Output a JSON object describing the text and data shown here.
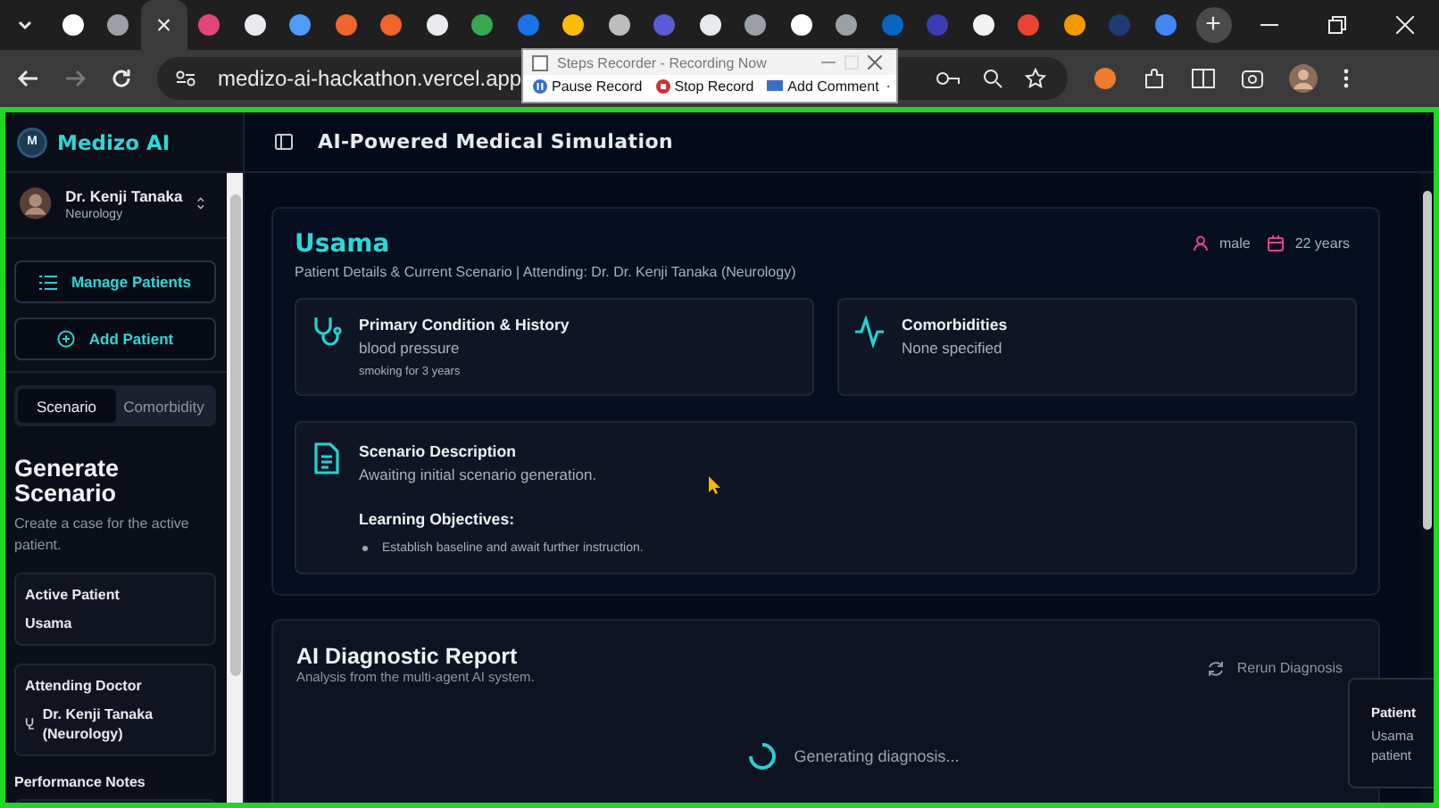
{
  "browser": {
    "tabs": [
      {
        "color": "#ffffff",
        "selected": false
      },
      {
        "color": "#9aa0a6",
        "selected": false
      },
      {
        "selected": true
      },
      {
        "color": "#e0457b",
        "selected": false
      },
      {
        "color": "#e8eaed",
        "selected": false
      },
      {
        "color": "#4f9cf7",
        "selected": false
      },
      {
        "color": "#f0642d",
        "selected": false
      },
      {
        "color": "#f0642d",
        "selected": false
      },
      {
        "color": "#e8eaed",
        "selected": false
      },
      {
        "color": "#34a853",
        "selected": false
      },
      {
        "color": "#1a73e8",
        "selected": false
      },
      {
        "color": "#fbbc05",
        "selected": false
      },
      {
        "color": "#bdbdbd",
        "selected": false
      },
      {
        "color": "#5b5bd6",
        "selected": false
      },
      {
        "color": "#e8eaed",
        "selected": false
      },
      {
        "color": "#9aa0a6",
        "selected": false
      },
      {
        "color": "#ffffff",
        "selected": false
      },
      {
        "color": "#9aa0a6",
        "selected": false
      },
      {
        "color": "#0a66c2",
        "selected": false
      },
      {
        "color": "#3b3bb5",
        "selected": false
      },
      {
        "color": "#f2f2f2",
        "selected": false
      },
      {
        "color": "#ea4335",
        "selected": false
      },
      {
        "color": "#f29900",
        "selected": false
      },
      {
        "color": "#1f3b73",
        "selected": false
      },
      {
        "color": "#4285f4",
        "selected": false
      }
    ],
    "close_glyph": "×",
    "new_tab": "+",
    "address": "medizo-ai-hackathon.vercel.app"
  },
  "recorder": {
    "title": "Steps Recorder - Recording Now",
    "buttons": [
      {
        "kind": "pause",
        "label": "Pause Record"
      },
      {
        "kind": "stop",
        "label": "Stop Record"
      },
      {
        "kind": "comment",
        "label": "Add Comment"
      }
    ]
  },
  "sidebar": {
    "brand": "Medizo AI",
    "logo": "M",
    "user": {
      "name": "Dr. Kenji Tanaka",
      "dept": "Neurology"
    },
    "nav": [
      {
        "kind": "list",
        "label": "Manage Patients"
      },
      {
        "kind": "add",
        "label": "Add Patient"
      }
    ],
    "tabs": [
      {
        "label": "Scenario",
        "selected": true
      },
      {
        "label": "Comorbidity",
        "selected": false
      }
    ],
    "title": "Generate Scenario",
    "subtitle": "Create a case for the active patient.",
    "fields": [
      {
        "kind": "text",
        "label": "Active Patient",
        "value": "Usama"
      },
      {
        "kind": "doctor",
        "label": "Attending Doctor",
        "value": "Dr. Kenji Tanaka (Neurology)"
      }
    ],
    "notes_label": "Performance Notes"
  },
  "header": {
    "title": "AI-Powered Medical Simulation"
  },
  "patient": {
    "name": "Usama",
    "subtitle": "Patient Details & Current Scenario | Attending: Dr. Dr. Kenji Tanaka (Neurology)",
    "sex": "male",
    "age": "22 years",
    "cards": [
      {
        "kind": "stethoscope",
        "title": "Primary Condition & History",
        "lines": [
          "blood pressure",
          "smoking for 3 years"
        ]
      },
      {
        "kind": "pulse",
        "title": "Comorbidities",
        "lines": [
          "None specified"
        ]
      }
    ],
    "scenario": {
      "title": "Scenario Description",
      "text": "Awaiting initial scenario generation.",
      "objectives_title": "Learning Objectives:",
      "objectives": [
        "Establish baseline and await further instruction."
      ]
    }
  },
  "report": {
    "title": "AI Diagnostic Report",
    "subtitle": "Analysis from the multi-agent AI system.",
    "action": "Rerun Diagnosis",
    "status": "Generating diagnosis..."
  },
  "toast": {
    "title": "Patient",
    "lines": [
      "Usama",
      "patient"
    ]
  }
}
